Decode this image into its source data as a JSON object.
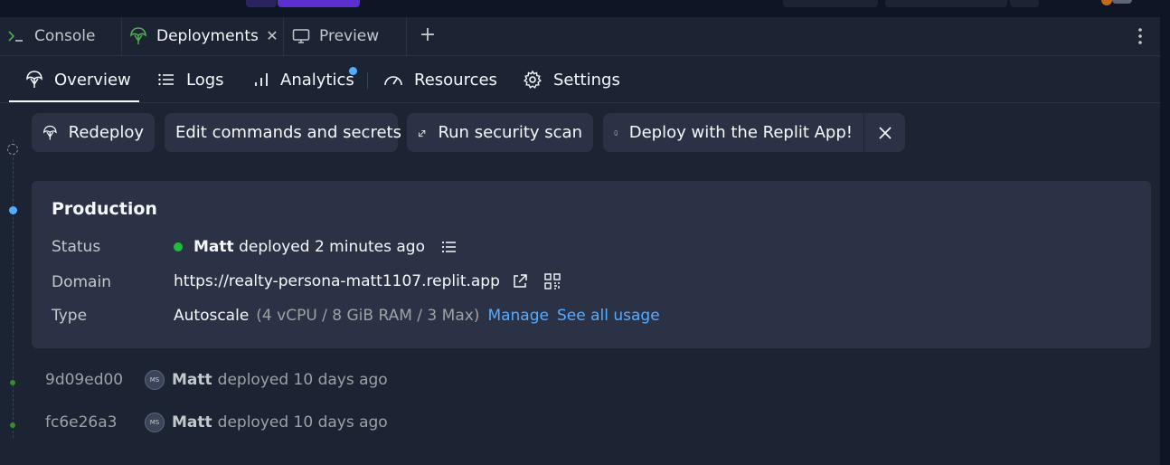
{
  "tabs": [
    {
      "label": "Console",
      "icon": "terminal-icon"
    },
    {
      "label": "Deployments",
      "icon": "deployments-icon",
      "active": true
    },
    {
      "label": "Preview",
      "icon": "monitor-icon"
    }
  ],
  "subnav": [
    {
      "label": "Overview",
      "icon": "deployments-icon",
      "active": true
    },
    {
      "label": "Logs",
      "icon": "list-icon"
    },
    {
      "label": "Analytics",
      "icon": "bar-chart-icon",
      "has_notification": true
    },
    {
      "label": "Resources",
      "icon": "gauge-icon"
    },
    {
      "label": "Settings",
      "icon": "gear-icon"
    }
  ],
  "actions": {
    "redeploy": "Redeploy",
    "edit": "Edit commands and secrets",
    "security_scan": "Run security scan",
    "deploy_app": "Deploy with the Replit App!"
  },
  "production": {
    "title": "Production",
    "status_label": "Status",
    "status_user": "Matt",
    "status_text": "deployed 2 minutes ago",
    "domain_label": "Domain",
    "domain_url": "https://realty-persona-matt1107.replit.app",
    "type_label": "Type",
    "type_value": "Autoscale",
    "type_specs": "(4 vCPU / 8 GiB RAM / 3 Max)",
    "manage_link": "Manage",
    "usage_link": "See all usage"
  },
  "history": [
    {
      "hash": "9d09ed00",
      "avatar": "MS",
      "user": "Matt",
      "text": "deployed 10 days ago"
    },
    {
      "hash": "fc6e26a3",
      "avatar": "MS",
      "user": "Matt",
      "text": "deployed 10 days ago"
    }
  ],
  "colors": {
    "background": "#0e1525",
    "panel": "#1c2333",
    "card": "#2b3245",
    "accent_blue": "#57abff",
    "status_green": "#1ebd3a"
  }
}
